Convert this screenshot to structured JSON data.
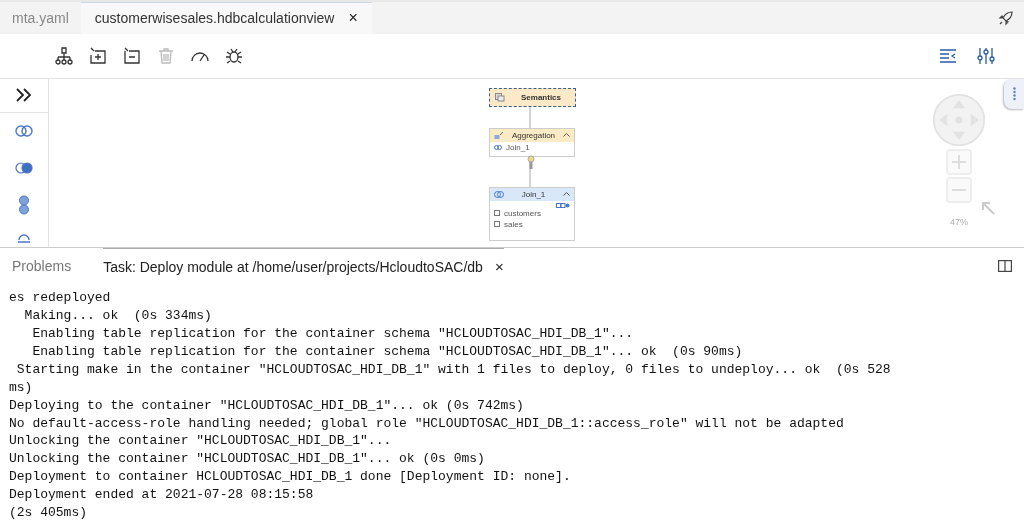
{
  "editor_tabs": [
    {
      "label": "mta.yaml",
      "selected": false
    },
    {
      "label": "customerwisesales.hdbcalculationview",
      "selected": true,
      "close": "×"
    }
  ],
  "toolbar": [
    {
      "kind": "hierarchy",
      "disabled": false
    },
    {
      "kind": "add",
      "disabled": false
    },
    {
      "kind": "remove",
      "disabled": false
    },
    {
      "kind": "delete",
      "disabled": true
    },
    {
      "kind": "gauge",
      "disabled": false
    },
    {
      "kind": "bug",
      "disabled": false
    }
  ],
  "palette": [
    {
      "kind": "expand"
    },
    {
      "kind": "union"
    },
    {
      "kind": "join"
    },
    {
      "kind": "projection"
    },
    {
      "kind": "rank"
    }
  ],
  "diagram": {
    "semantics": {
      "title": "Semantics",
      "selected": true
    },
    "aggregation": {
      "title": "Aggregation",
      "inputs": [
        "Join_1"
      ]
    },
    "join": {
      "title": "Join_1",
      "tables": [
        "customers",
        "sales"
      ]
    },
    "zoom_label": "47%"
  },
  "panel_tabs": [
    {
      "label": "Problems",
      "selected": false
    },
    {
      "label": "Task: Deploy module at /home/user/projects/HcloudtoSAC/db",
      "selected": true,
      "close": "×"
    }
  ],
  "console": [
    "es redeployed",
    "  Making... ok  (0s 334ms)",
    "   Enabling table replication for the container schema \"HCLOUDTOSAC_HDI_DB_1\"...",
    "   Enabling table replication for the container schema \"HCLOUDTOSAC_HDI_DB_1\"... ok  (0s 90ms)",
    " Starting make in the container \"HCLOUDTOSAC_HDI_DB_1\" with 1 files to deploy, 0 files to undeploy... ok  (0s 528",
    "ms)",
    "Deploying to the container \"HCLOUDTOSAC_HDI_DB_1\"... ok (0s 742ms)",
    "No default-access-role handling needed; global role \"HCLOUDTOSAC_HDI_DB_1::access_role\" will not be adapted",
    "Unlocking the container \"HCLOUDTOSAC_HDI_DB_1\"...",
    "Unlocking the container \"HCLOUDTOSAC_HDI_DB_1\"... ok (0s 0ms)",
    "Deployment to container HCLOUDTOSAC_HDI_DB_1 done [Deployment ID: none].",
    "Deployment ended at 2021-07-28 08:15:58",
    "(2s 405ms)"
  ]
}
